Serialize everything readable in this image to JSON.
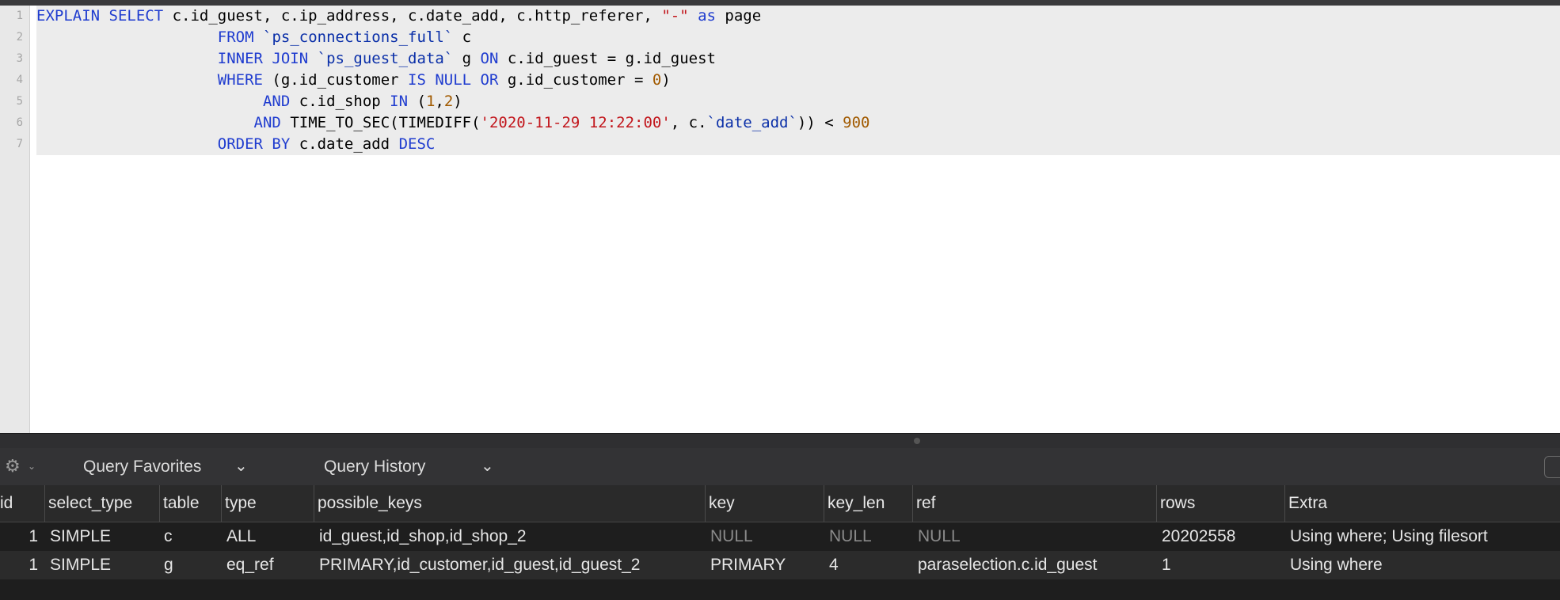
{
  "editor": {
    "line_numbers": [
      "1",
      "2",
      "3",
      "4",
      "5",
      "6",
      "7"
    ],
    "lines": [
      {
        "tokens": [
          {
            "t": "EXPLAIN SELECT",
            "c": "kw"
          },
          {
            "t": " c.id_guest, c.ip_address, c.date_add, c.http_referer, ",
            "c": ""
          },
          {
            "t": "\"-\"",
            "c": "str"
          },
          {
            "t": " ",
            "c": ""
          },
          {
            "t": "as",
            "c": "kw"
          },
          {
            "t": " page",
            "c": ""
          }
        ]
      },
      {
        "tokens": [
          {
            "t": "                    ",
            "c": ""
          },
          {
            "t": "FROM",
            "c": "kw"
          },
          {
            "t": " ",
            "c": ""
          },
          {
            "t": "`ps_connections_full`",
            "c": "bt"
          },
          {
            "t": " c",
            "c": ""
          }
        ]
      },
      {
        "tokens": [
          {
            "t": "                    ",
            "c": ""
          },
          {
            "t": "INNER JOIN",
            "c": "kw"
          },
          {
            "t": " ",
            "c": ""
          },
          {
            "t": "`ps_guest_data`",
            "c": "bt"
          },
          {
            "t": " g ",
            "c": ""
          },
          {
            "t": "ON",
            "c": "kw"
          },
          {
            "t": " c.id_guest = g.id_guest",
            "c": ""
          }
        ]
      },
      {
        "tokens": [
          {
            "t": "                    ",
            "c": ""
          },
          {
            "t": "WHERE",
            "c": "kw"
          },
          {
            "t": " (g.id_customer ",
            "c": ""
          },
          {
            "t": "IS NULL OR",
            "c": "kw"
          },
          {
            "t": " g.id_customer = ",
            "c": ""
          },
          {
            "t": "0",
            "c": "num"
          },
          {
            "t": ")",
            "c": ""
          }
        ]
      },
      {
        "tokens": [
          {
            "t": "                         ",
            "c": ""
          },
          {
            "t": "AND",
            "c": "kw"
          },
          {
            "t": " c.id_shop ",
            "c": ""
          },
          {
            "t": "IN",
            "c": "kw"
          },
          {
            "t": " (",
            "c": ""
          },
          {
            "t": "1",
            "c": "num"
          },
          {
            "t": ",",
            "c": ""
          },
          {
            "t": "2",
            "c": "num"
          },
          {
            "t": ")",
            "c": ""
          }
        ]
      },
      {
        "tokens": [
          {
            "t": "                        ",
            "c": ""
          },
          {
            "t": "AND",
            "c": "kw"
          },
          {
            "t": " TIME_TO_SEC(TIMEDIFF(",
            "c": ""
          },
          {
            "t": "'2020-11-29 12:22:00'",
            "c": "str"
          },
          {
            "t": ", c.",
            "c": ""
          },
          {
            "t": "`date_add`",
            "c": "bt"
          },
          {
            "t": ")) < ",
            "c": ""
          },
          {
            "t": "900",
            "c": "num"
          }
        ]
      },
      {
        "tokens": [
          {
            "t": "                    ",
            "c": ""
          },
          {
            "t": "ORDER BY",
            "c": "kw"
          },
          {
            "t": " c.date_add ",
            "c": ""
          },
          {
            "t": "DESC",
            "c": "kw"
          }
        ]
      }
    ]
  },
  "toolbar": {
    "gear_icon": "⚙",
    "gear_caret": "⌄",
    "query_favorites_label": "Query Favorites",
    "query_history_label": "Query History",
    "chevron": "⌄"
  },
  "results": {
    "columns": [
      "id",
      "select_type",
      "table",
      "type",
      "possible_keys",
      "key",
      "key_len",
      "ref",
      "rows",
      "Extra"
    ],
    "rows": [
      [
        "1",
        "SIMPLE",
        "c",
        "ALL",
        "id_guest,id_shop,id_shop_2",
        "NULL",
        "NULL",
        "NULL",
        "20202558",
        "Using where; Using filesort"
      ],
      [
        "1",
        "SIMPLE",
        "g",
        "eq_ref",
        "PRIMARY,id_customer,id_guest,id_guest_2",
        "PRIMARY",
        "4",
        "paraselection.c.id_guest",
        "1",
        "Using where"
      ]
    ]
  }
}
